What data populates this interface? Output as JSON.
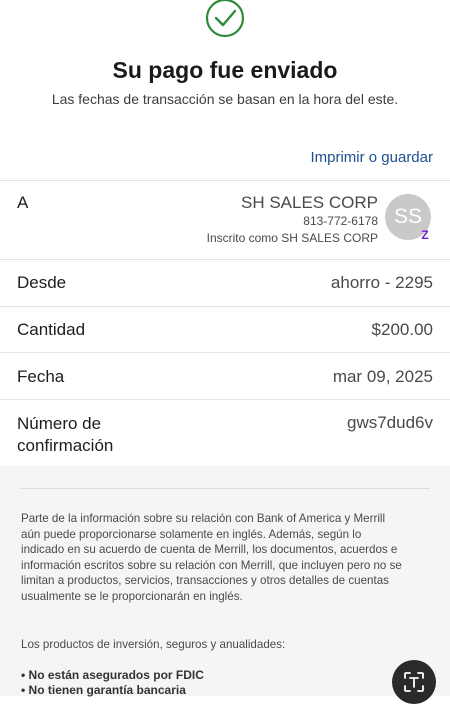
{
  "header": {
    "title": "Su pago fue enviado",
    "subtitle": "Las fechas de transacción se basan en la hora del este.",
    "print_label": "Imprimir o guardar"
  },
  "payee": {
    "label": "A",
    "name": "SH SALES CORP",
    "phone": "813-772-6178",
    "enrolled": "Inscrito como SH SALES CORP",
    "avatar_initials": "SS",
    "badge_glyph": "Z",
    "avatar_color": "#c9c9c9",
    "badge_color": "#6d1ed4"
  },
  "details": {
    "from_label": "Desde",
    "from_value": "ahorro - 2295",
    "amount_label": "Cantidad",
    "amount_value": "$200.00",
    "date_label": "Fecha",
    "date_value": "mar 09, 2025",
    "confirmation_label": "Número de confirmación",
    "confirmation_value": "gws7dud6v"
  },
  "disclaimer": {
    "paragraph": "Parte de la información sobre su relación con Bank of America y Merrill aún puede proporcionarse solamente en inglés. Además, según lo indicado en su acuerdo de cuenta de Merrill, los documentos, acuerdos e información escritos sobre su relación con Merrill, que incluyen pero no se limitan a productos, servicios, transacciones y otros detalles de cuentas usualmente se le proporcionarán en inglés.",
    "investment_intro": "Los productos de inversión, seguros y anualidades:",
    "bullets": [
      "• No están asegurados por FDIC",
      "• No tienen garantía bancaria"
    ]
  },
  "icons": {
    "success": "check-circle-icon",
    "scan": "scan-text-icon"
  },
  "colors": {
    "accent": "#1f4f8f",
    "success": "#2e8b3a"
  }
}
